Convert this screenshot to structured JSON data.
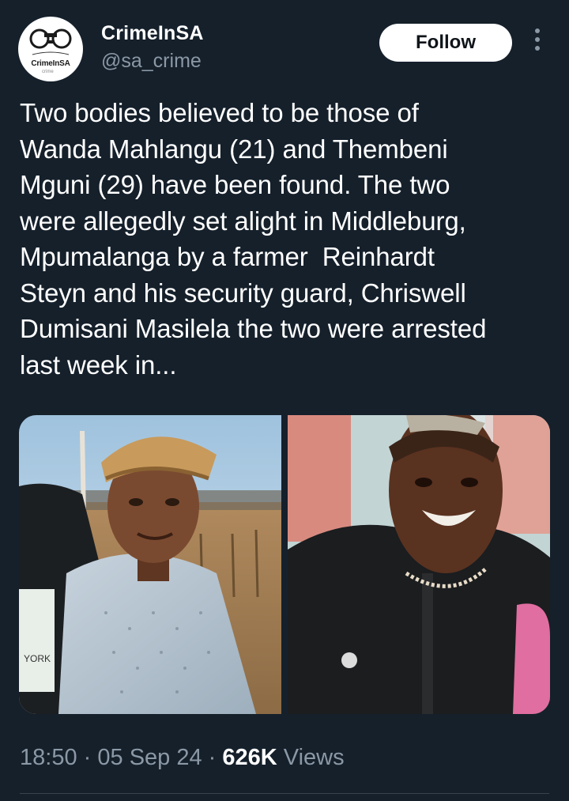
{
  "profile": {
    "avatar_text": "CrimeInSA",
    "avatar_subtext": "crime",
    "display_name": "CrimeInSA",
    "handle": "@sa_crime",
    "follow_label": "Follow",
    "more_icon": "more-vertical-icon"
  },
  "tweet": {
    "text_lines": [
      "Two bodies believed to be those of",
      "Wanda Mahlangu (21) and Thembeni",
      "Mguni (29) have been found. The two",
      "were allegedly set alight in Middleburg,",
      "Mpumalanga by a farmer  Reinhardt",
      "Steyn and his security guard, Chriswell",
      "Dumisani Masilela the two were arrested",
      "last week in..."
    ],
    "media": {
      "left_photo_caption": "YORK"
    },
    "time": "18:50",
    "separator": "·",
    "date": "05 Sep 24",
    "views_count": "626K",
    "views_label": "Views"
  },
  "colors": {
    "background": "#15202b",
    "text_primary": "#ffffff",
    "text_secondary": "#8b98a5",
    "divider": "#38444d",
    "follow_bg": "#ffffff"
  }
}
